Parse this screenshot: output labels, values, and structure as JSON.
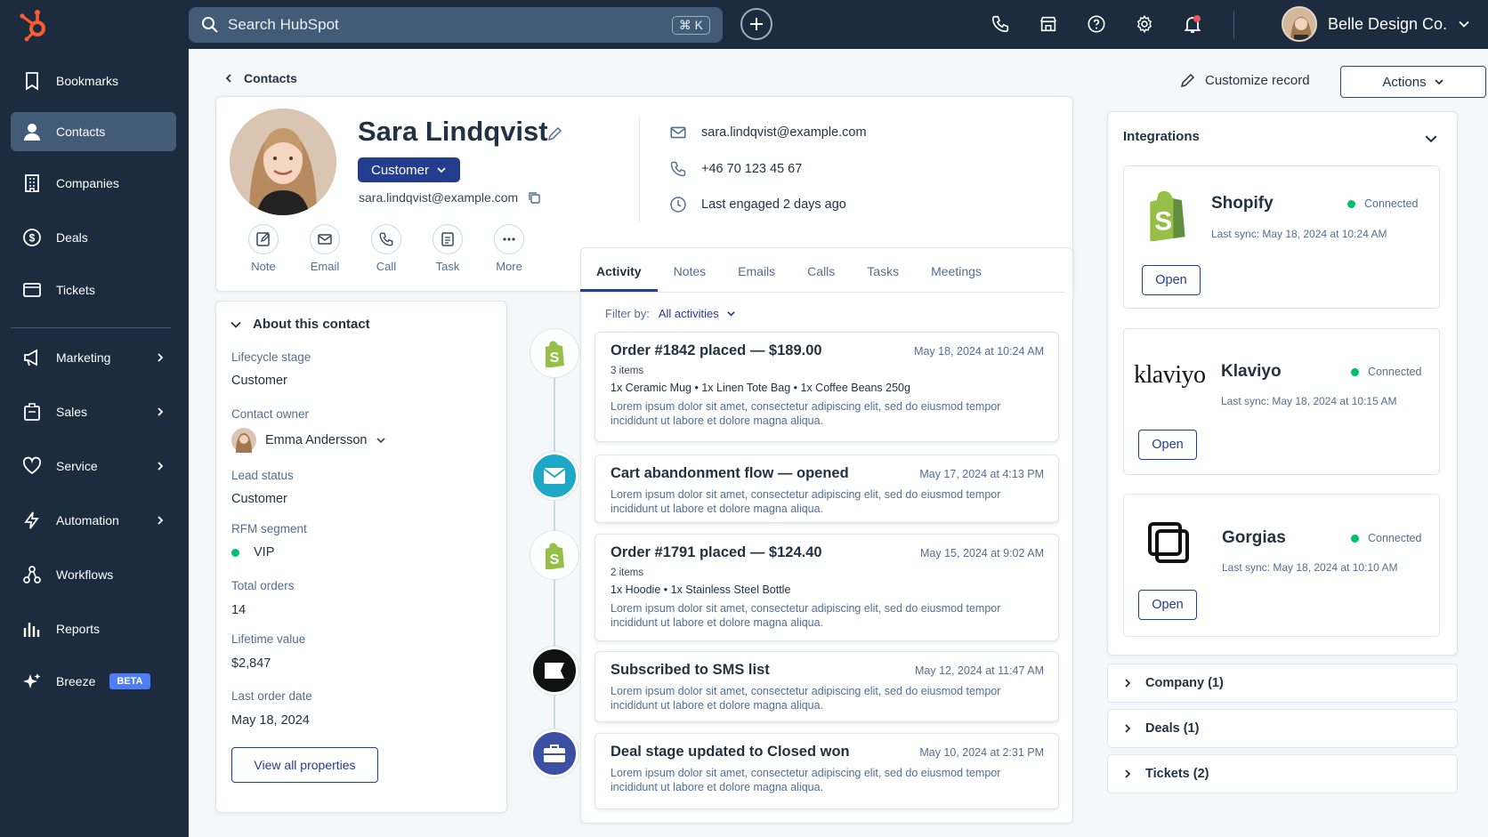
{
  "topbar": {
    "search_placeholder": "Search HubSpot",
    "shortcut": "⌘ K",
    "account_name": "Belle Design Co."
  },
  "sidebar": {
    "items": [
      {
        "label": "Bookmarks",
        "icon": "bookmark-icon"
      },
      {
        "label": "Contacts",
        "icon": "person-icon",
        "active": true
      },
      {
        "label": "Companies",
        "icon": "building-icon"
      },
      {
        "label": "Deals",
        "icon": "dollar-icon"
      },
      {
        "label": "Tickets",
        "icon": "ticket-icon"
      },
      {
        "label": "Marketing",
        "icon": "megaphone-icon"
      },
      {
        "label": "Sales",
        "icon": "briefcase-icon"
      },
      {
        "label": "Service",
        "icon": "heart-icon"
      },
      {
        "label": "Automation",
        "icon": "lightning-icon"
      },
      {
        "label": "Workflows",
        "icon": "workflow-icon"
      },
      {
        "label": "Reports",
        "icon": "chart-icon"
      },
      {
        "label": "Breeze",
        "icon": "sparkle-icon"
      }
    ],
    "beta": "BETA"
  },
  "header": {
    "breadcrumb": "Contacts",
    "customize": "Customize record",
    "actions": "Actions"
  },
  "profile": {
    "name": "Sara Lindqvist",
    "status": "Customer",
    "email": "sara.lindqvist@example.com",
    "quick_actions": [
      "Note",
      "Email",
      "Call",
      "Task",
      "More"
    ],
    "contact_email": "sara.lindqvist@example.com",
    "phone": "+46 70 123 45 67",
    "last_engaged": "Last engaged 2 days ago"
  },
  "about": {
    "title": "About this contact",
    "lifecycle_label": "Lifecycle stage",
    "lifecycle": "Customer",
    "owner_label": "Contact owner",
    "owner": "Emma Andersson",
    "lead_label": "Lead status",
    "lead": "Customer",
    "rfm_label": "RFM segment",
    "rfm": "VIP",
    "orders_label": "Total orders",
    "orders": "14",
    "ltv_label": "Lifetime value",
    "ltv": "$2,847",
    "lastorder_label": "Last order date",
    "lastorder": "May 18, 2024",
    "view_all": "View all properties"
  },
  "activity": {
    "tabs": [
      "Activity",
      "Notes",
      "Emails",
      "Calls",
      "Tasks",
      "Meetings"
    ],
    "filter_label": "Filter by:",
    "filter_value": "All activities",
    "items": [
      {
        "title": "Order #1842 placed — $189.00",
        "date": "May 18, 2024 at 10:24 AM",
        "sub": "3 items",
        "items": "1x Ceramic Mug  •  1x Linen Tote Bag  •  1x Coffee Beans 250g",
        "lorem": "Lorem ipsum dolor sit amet, consectetur adipiscing elit, sed do eiusmod tempor incididunt ut labore et dolore magna aliqua."
      },
      {
        "title": "Cart abandonment flow — opened",
        "date": "May 17, 2024 at 4:13 PM",
        "lorem": "Lorem ipsum dolor sit amet, consectetur adipiscing elit, sed do eiusmod tempor incididunt ut labore et dolore magna aliqua."
      },
      {
        "title": "Order #1791 placed — $124.40",
        "date": "May 15, 2024 at 9:02 AM",
        "sub": "2 items",
        "items": "1x Hoodie  •  1x Stainless Steel Bottle",
        "lorem": "Lorem ipsum dolor sit amet, consectetur adipiscing elit, sed do eiusmod tempor incididunt ut labore et dolore magna aliqua."
      },
      {
        "title": "Subscribed to SMS list",
        "date": "May 12, 2024 at 11:47 AM",
        "lorem": "Lorem ipsum dolor sit amet, consectetur adipiscing elit, sed do eiusmod tempor incididunt ut labore et dolore magna aliqua."
      },
      {
        "title": "Deal stage updated to Closed won",
        "date": "May 10, 2024 at 2:31 PM",
        "lorem": "Lorem ipsum dolor sit amet, consectetur adipiscing elit, sed do eiusmod tempor incididunt ut labore et dolore magna aliqua."
      }
    ]
  },
  "integrations": {
    "title": "Integrations",
    "list": [
      {
        "name": "Shopify",
        "status": "Connected",
        "sync": "Last sync: May 18, 2024 at 10:24 AM",
        "open": "Open"
      },
      {
        "name": "Klaviyo",
        "logo_text": "klaviyo",
        "status": "Connected",
        "sync": "Last sync: May 18, 2024 at 10:15 AM",
        "open": "Open"
      },
      {
        "name": "Gorgias",
        "status": "Connected",
        "sync": "Last sync: May 18, 2024 at 10:10 AM",
        "open": "Open"
      }
    ]
  },
  "associations": [
    {
      "label": "Company (1)"
    },
    {
      "label": "Deals (1)"
    },
    {
      "label": "Tickets (2)"
    }
  ],
  "colors": {
    "nav_bg": "#1c2b3d",
    "accent": "#233d8f",
    "orange": "#ff5c35",
    "connected": "#00bf6f"
  }
}
